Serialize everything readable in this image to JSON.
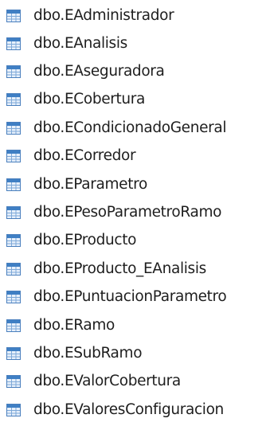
{
  "tree": {
    "icon": "table-icon",
    "icon_colors": {
      "header": "#3f7fc4",
      "body": "#e7f0fb",
      "grid": "#7ea9d8",
      "border": "#4a7fbd"
    },
    "items": [
      {
        "label": "dbo.EAdministrador"
      },
      {
        "label": "dbo.EAnalisis"
      },
      {
        "label": "dbo.EAseguradora"
      },
      {
        "label": "dbo.ECobertura"
      },
      {
        "label": "dbo.ECondicionadoGeneral"
      },
      {
        "label": "dbo.ECorredor"
      },
      {
        "label": "dbo.EParametro"
      },
      {
        "label": "dbo.EPesoParametroRamo"
      },
      {
        "label": "dbo.EProducto"
      },
      {
        "label": "dbo.EProducto_EAnalisis"
      },
      {
        "label": "dbo.EPuntuacionParametro"
      },
      {
        "label": "dbo.ERamo"
      },
      {
        "label": "dbo.ESubRamo"
      },
      {
        "label": "dbo.EValorCobertura"
      },
      {
        "label": "dbo.EValoresConfiguracion"
      }
    ]
  }
}
